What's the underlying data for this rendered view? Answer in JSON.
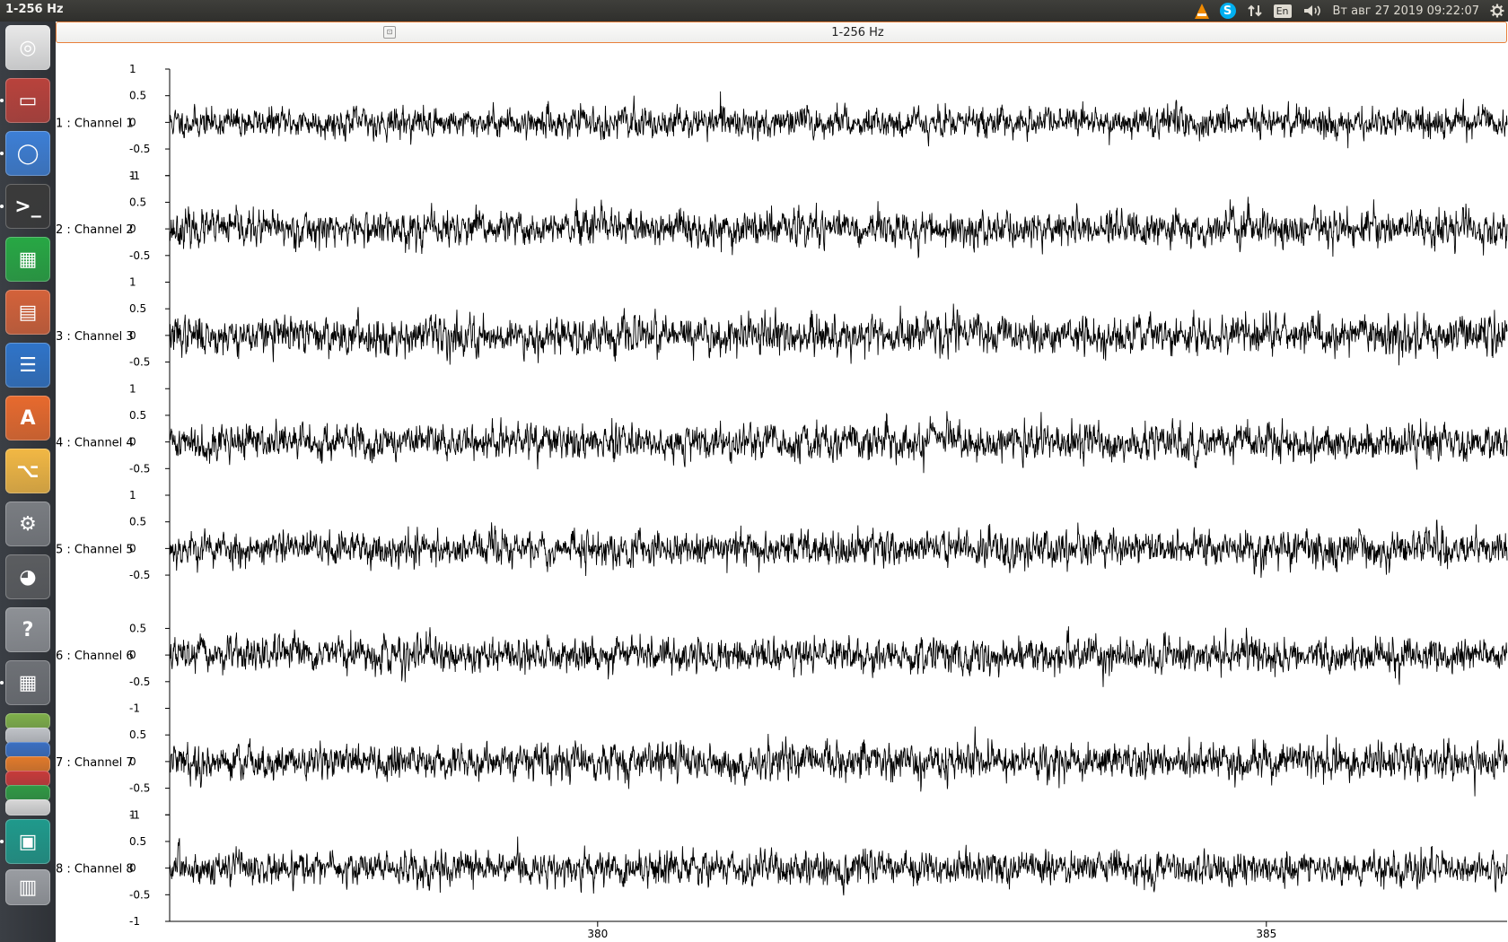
{
  "topbar": {
    "app_title": "1-256 Hz",
    "keyboard_layout": "En",
    "datetime": "Вт авг 27 2019 09:22:07",
    "skype_letter": "S"
  },
  "launcher": {
    "items": [
      {
        "name": "ubuntu-dash-icon",
        "color": "#e9e9e9",
        "glyph": "◎",
        "running": false
      },
      {
        "name": "file-manager-icon",
        "color": "#b9423c",
        "glyph": "▭",
        "running": true
      },
      {
        "name": "chromium-browser-icon",
        "color": "#3d7fd6",
        "glyph": "◯",
        "running": true
      },
      {
        "name": "terminal-icon",
        "color": "#3a3a3a",
        "glyph": ">_",
        "running": true
      },
      {
        "name": "libreoffice-calc-icon",
        "color": "#27a844",
        "glyph": "▦",
        "running": false
      },
      {
        "name": "libreoffice-impress-icon",
        "color": "#d4623a",
        "glyph": "▤",
        "running": false
      },
      {
        "name": "libreoffice-writer-icon",
        "color": "#2f74c9",
        "glyph": "☰",
        "running": false
      },
      {
        "name": "software-center-icon",
        "color": "#e86a2e",
        "glyph": "A",
        "running": false
      },
      {
        "name": "schematic-editor-icon",
        "color": "#f2b844",
        "glyph": "⌥",
        "running": false
      },
      {
        "name": "system-settings-icon",
        "color": "#7a7d82",
        "glyph": "⚙",
        "running": false
      },
      {
        "name": "gimp-icon",
        "color": "#5b5d60",
        "glyph": "◕",
        "running": false
      },
      {
        "name": "help-icon",
        "color": "#8e9196",
        "glyph": "?",
        "running": false
      },
      {
        "name": "calculator-icon",
        "color": "#6e7176",
        "glyph": "▦",
        "running": true
      }
    ],
    "stacked_items": [
      {
        "name": "monkey-app-icon",
        "color": "#7fb04a"
      },
      {
        "name": "app-icon-2",
        "color": "#c0c3c8"
      },
      {
        "name": "mx-app-icon",
        "color": "#3a6fc2"
      },
      {
        "name": "app-icon-4",
        "color": "#e27a2a"
      },
      {
        "name": "app-icon-5",
        "color": "#c83a3a"
      },
      {
        "name": "app-icon-6",
        "color": "#2f9a44"
      },
      {
        "name": "app-icon-7",
        "color": "#d8d8d8"
      }
    ],
    "bottom_items": [
      {
        "name": "active-app-icon",
        "color": "#1f9a8c",
        "glyph": "▣",
        "running": true
      },
      {
        "name": "trash-icon",
        "color": "#9a9da2",
        "glyph": "▥",
        "running": false
      }
    ]
  },
  "header": {
    "title": "1-256 Hz"
  },
  "plot": {
    "trace_color": "#000000",
    "channels": [
      {
        "label": "1 : Channel 1",
        "ticks": [
          "1",
          "0.5",
          "0",
          "-0.5",
          "-1"
        ]
      },
      {
        "label": "2 : Channel 2",
        "ticks": [
          "1",
          "0.5",
          "0",
          "-0.5"
        ]
      },
      {
        "label": "3 : Channel 3",
        "ticks": [
          "1",
          "0.5",
          "0",
          "-0.5"
        ]
      },
      {
        "label": "4 : Channel 4",
        "ticks": [
          "1",
          "0.5",
          "0",
          "-0.5"
        ]
      },
      {
        "label": "5 : Channel 5",
        "ticks": [
          "1",
          "0.5",
          "0",
          "-0.5"
        ]
      },
      {
        "label": "6 : Channel 6",
        "ticks": [
          "0.5",
          "0",
          "-0.5",
          "-1"
        ]
      },
      {
        "label": "7 : Channel 7",
        "ticks": [
          "0.5",
          "0",
          "-0.5",
          "-1"
        ]
      },
      {
        "label": "8 : Channel 8",
        "ticks": [
          "1",
          "0.5",
          "0",
          "-0.5",
          "-1"
        ]
      }
    ],
    "x_ticks": [
      "380",
      "385"
    ]
  },
  "chart_data": {
    "type": "line",
    "xlabel": "",
    "ylabel": "",
    "x_ticks": [
      380,
      385
    ],
    "xlim": [
      376.8,
      386.8
    ],
    "ylim_per_channel": [
      -1,
      1
    ],
    "grid": false,
    "series": [
      {
        "name": "1 : Channel 1",
        "amplitude": 0.35,
        "seed": 11
      },
      {
        "name": "2 : Channel 2",
        "amplitude": 0.42,
        "seed": 23
      },
      {
        "name": "3 : Channel 3",
        "amplitude": 0.45,
        "seed": 37
      },
      {
        "name": "4 : Channel 4",
        "amplitude": 0.42,
        "seed": 41
      },
      {
        "name": "5 : Channel 5",
        "amplitude": 0.42,
        "seed": 53
      },
      {
        "name": "6 : Channel 6",
        "amplitude": 0.4,
        "seed": 67
      },
      {
        "name": "7 : Channel 7",
        "amplitude": 0.42,
        "seed": 79
      },
      {
        "name": "8 : Channel 8",
        "amplitude": 0.4,
        "seed": 83
      }
    ]
  }
}
